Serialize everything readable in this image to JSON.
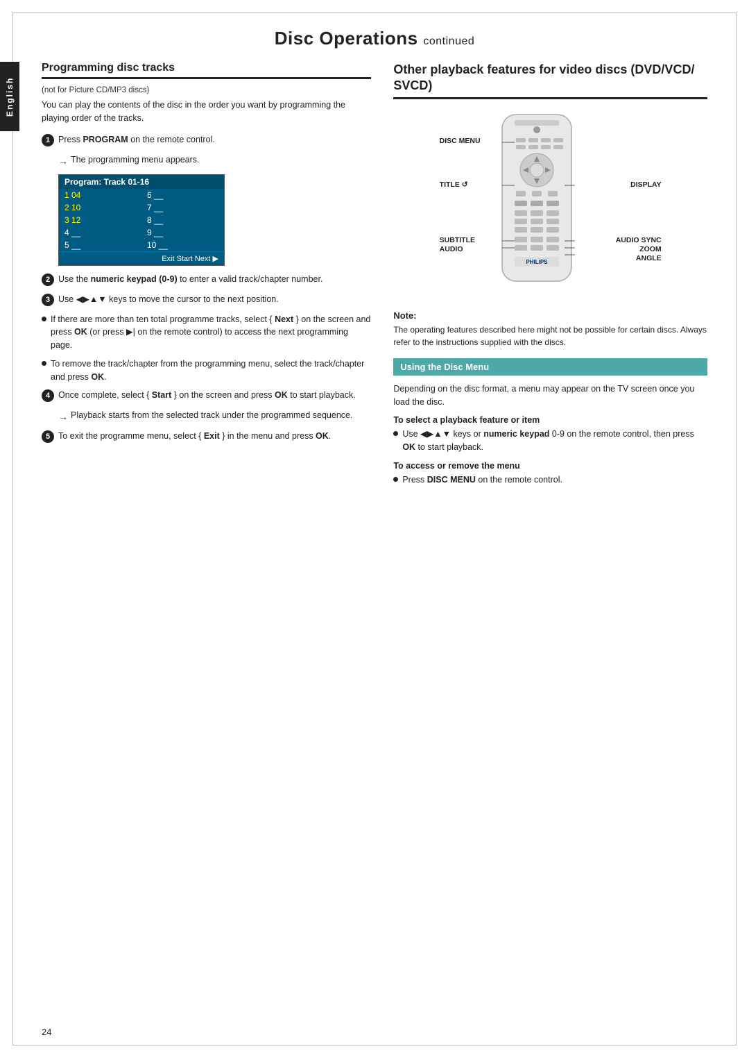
{
  "page": {
    "title": "Disc Operations",
    "title_continued": "continued",
    "page_number": "24"
  },
  "sidebar": {
    "label": "English"
  },
  "left_section": {
    "heading": "Programming disc tracks",
    "subtitle": "(not for Picture CD/MP3 discs)",
    "intro": "You can play the contents of the disc in the order you want by programming the playing order of the tracks.",
    "step1": {
      "num": "1",
      "text_prefix": "Press ",
      "bold": "PROGRAM",
      "text_suffix": " on the remote control.",
      "arrow_text": "The programming menu appears."
    },
    "program_table": {
      "header": "Program: Track 01-16",
      "rows": [
        {
          "col1": "1  04",
          "col2": "6  __"
        },
        {
          "col1": "2  10",
          "col2": "7  __"
        },
        {
          "col1": "3  12",
          "col2": "8  __"
        },
        {
          "col1": "4  __",
          "col2": "9  __"
        },
        {
          "col1": "5  __",
          "col2": "10 __"
        }
      ],
      "footer": "Exit   Start   Next ▶"
    },
    "step2": {
      "num": "2",
      "text": "Use the numeric keypad (0-9) to enter a valid track/chapter number."
    },
    "step3": {
      "num": "3",
      "text": "Use ◀▶▲▼ keys to move the cursor to the next position."
    },
    "bullet1": "If there are more than ten total programme tracks, select { Next } on the screen and press OK (or press ▶| on the remote control) to access the next programming page.",
    "bullet2": "To remove the track/chapter from the programming menu, select the track/chapter and press OK.",
    "step4": {
      "num": "4",
      "text_start": "Once complete, select { Start } on the screen and press ",
      "bold": "OK",
      "text_end": " to start playback.",
      "arrow_text": "Playback starts from the selected track under the programmed sequence."
    },
    "step5": {
      "num": "5",
      "text_start": "To exit the programme menu, select { Exit } in the menu and press ",
      "bold": "OK",
      "text_end": "."
    }
  },
  "right_section": {
    "heading": "Other playback features for video discs (DVD/VCD/ SVCD)",
    "labels": {
      "disc_menu": "DISC MENU",
      "title": "TITLE ↺",
      "subtitle": "SUBTITLE",
      "audio": "AUDIO",
      "display": "DISPLAY",
      "audio_sync": "AUDIO SYNC",
      "zoom": "ZOOM",
      "angle": "ANGLE",
      "brand": "PHILIPS"
    },
    "note": {
      "title": "Note:",
      "text": "The operating features described here might not be possible for certain discs. Always refer to the instructions supplied with the discs."
    },
    "disc_menu_section": {
      "heading": "Using the Disc Menu",
      "intro": "Depending on the disc format, a menu may appear on the TV screen once you load the disc.",
      "feature_heading": "To select a playback feature or item",
      "bullet1_start": "Use ◀▶▲▼ keys or ",
      "bullet1_bold": "numeric keypad",
      "bullet1_end": " 0-9 on the remote control, then press OK to start playback.",
      "access_heading": "To access or remove the menu",
      "bullet2_start": "Press ",
      "bullet2_bold": "DISC MENU",
      "bullet2_end": " on the remote control."
    }
  }
}
